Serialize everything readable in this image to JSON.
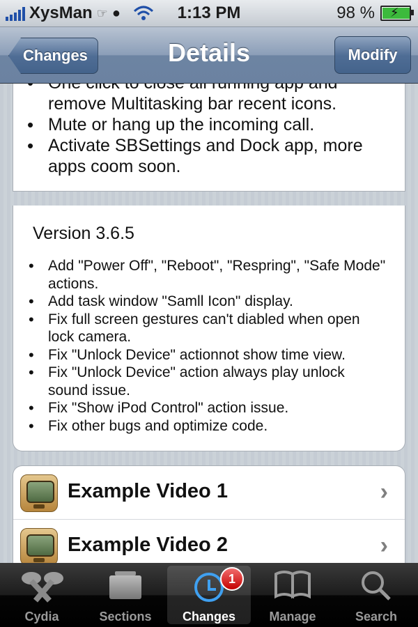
{
  "status_bar": {
    "carrier": "XysMan",
    "time": "1:13 PM",
    "battery": "98 %",
    "battery_level": 0.98
  },
  "nav": {
    "back_label": "Changes",
    "title": "Details",
    "modify_label": "Modify"
  },
  "features": [
    "One click to close all running app and remove Multitasking bar recent icons.",
    "Mute or hang up the incoming call.",
    "Activate SBSettings and Dock app, more apps coom soon."
  ],
  "version": {
    "title": "Version 3.6.5",
    "notes": [
      "Add \"Power Off\", \"Reboot\", \"Respring\", \"Safe Mode\" actions.",
      "Add task window \"Samll Icon\" display.",
      "Fix full screen gestures can't diabled when open lock camera.",
      "Fix \"Unlock Device\" actionnot show time view.",
      "Fix \"Unlock Device\" action always play unlock sound issue.",
      "Fix \"Show iPod Control\" action issue.",
      "Fix other bugs and optimize code."
    ]
  },
  "videos": [
    {
      "label": "Example Video 1",
      "icon": "video-icon"
    },
    {
      "label": "Example Video 2",
      "icon": "video-icon"
    }
  ],
  "tabs": [
    {
      "label": "Cydia",
      "icon": "cydia-icon"
    },
    {
      "label": "Sections",
      "icon": "sections-icon"
    },
    {
      "label": "Changes",
      "icon": "clock-icon",
      "badge": "1",
      "active": true
    },
    {
      "label": "Manage",
      "icon": "book-icon"
    },
    {
      "label": "Search",
      "icon": "search-icon"
    }
  ]
}
